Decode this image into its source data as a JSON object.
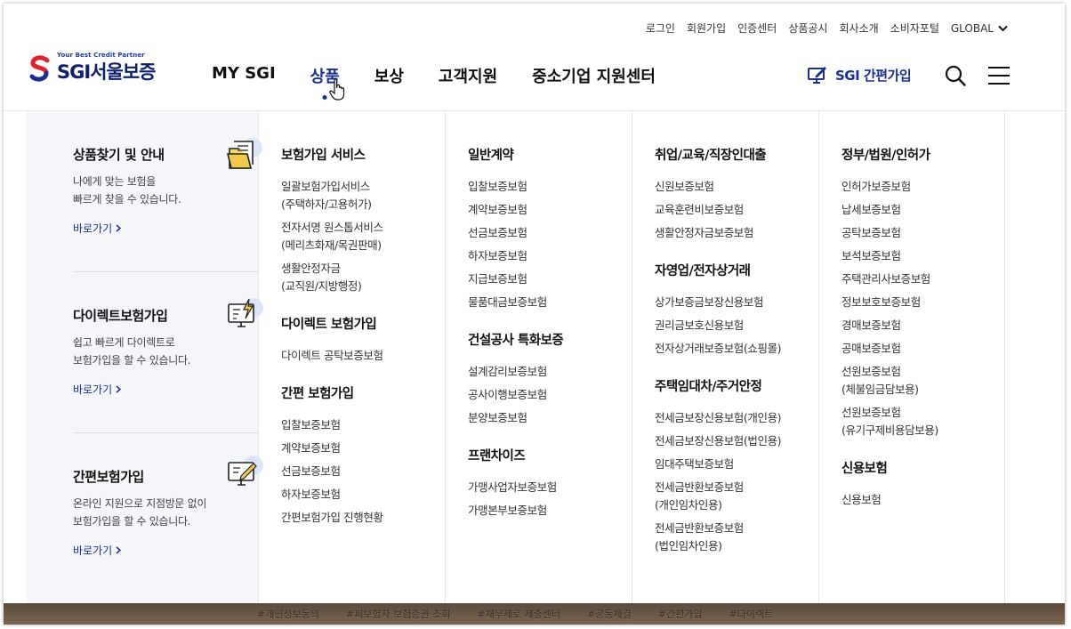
{
  "util_nav": [
    "로그인",
    "회원가입",
    "인증센터",
    "상품공시",
    "회사소개",
    "소비자포털"
  ],
  "global_label": "GLOBAL",
  "logo": {
    "tagline": "Your Best Credit Partner",
    "name": "SGI서울보증"
  },
  "gnb": [
    {
      "label": "MY SGI"
    },
    {
      "label": "상품"
    },
    {
      "label": "보상"
    },
    {
      "label": "고객지원"
    },
    {
      "label": "중소기업 지원센터"
    }
  ],
  "quick_join": "SGI 간편가입",
  "side_cards": [
    {
      "title": "상품찾기 및 안내",
      "desc1": "나에게 맞는 보험을",
      "desc2": "빠르게 찾을 수 있습니다.",
      "link": "바로가기",
      "icon": "document-folder-icon"
    },
    {
      "title": "다이렉트보험가입",
      "desc1": "쉽고 빠르게 다이렉트로",
      "desc2": "보험가입을 할 수 있습니다.",
      "link": "바로가기",
      "icon": "monitor-lightning-icon"
    },
    {
      "title": "간편보험가입",
      "desc1": "온라인 지원으로 지점방문 없이",
      "desc2": "보험가입을 할 수 있습니다.",
      "link": "바로가기",
      "icon": "monitor-pen-icon"
    }
  ],
  "columns": [
    {
      "groups": [
        {
          "title": "보험가입 서비스",
          "items": [
            {
              "l1": "일괄보험가입서비스",
              "l2": "(주택하자/고용허가)"
            },
            {
              "l1": "전자서명 원스톱서비스",
              "l2": "(메리츠화재/목권판매)"
            },
            {
              "l1": "생활안정자금",
              "l2": "(교직원/지방행정)"
            }
          ]
        },
        {
          "title": "다이렉트 보험가입",
          "items": [
            {
              "l1": "다이렉트 공탁보증보험",
              "l2": ""
            }
          ]
        },
        {
          "title": "간편 보험가입",
          "items": [
            {
              "l1": "입찰보증보험",
              "l2": ""
            },
            {
              "l1": "계약보증보험",
              "l2": ""
            },
            {
              "l1": "선금보증보험",
              "l2": ""
            },
            {
              "l1": "하자보증보험",
              "l2": ""
            },
            {
              "l1": "간편보험가입 진행현황",
              "l2": ""
            }
          ]
        }
      ]
    },
    {
      "groups": [
        {
          "title": "일반계약",
          "items": [
            {
              "l1": "입찰보증보험",
              "l2": ""
            },
            {
              "l1": "계약보증보험",
              "l2": ""
            },
            {
              "l1": "선금보증보험",
              "l2": ""
            },
            {
              "l1": "하자보증보험",
              "l2": ""
            },
            {
              "l1": "지급보증보험",
              "l2": ""
            },
            {
              "l1": "물품대금보증보험",
              "l2": ""
            }
          ]
        },
        {
          "title": "건설공사 특화보증",
          "items": [
            {
              "l1": "설계감리보증보험",
              "l2": ""
            },
            {
              "l1": "공사이행보증보험",
              "l2": ""
            },
            {
              "l1": "분양보증보험",
              "l2": ""
            }
          ]
        },
        {
          "title": "프랜차이즈",
          "items": [
            {
              "l1": "가맹사업자보증보험",
              "l2": ""
            },
            {
              "l1": "가맹본부보증보험",
              "l2": ""
            }
          ]
        }
      ]
    },
    {
      "groups": [
        {
          "title": "취업/교육/직장인대출",
          "items": [
            {
              "l1": "신원보증보험",
              "l2": ""
            },
            {
              "l1": "교육훈련비보증보험",
              "l2": ""
            },
            {
              "l1": "생활안정자금보증보험",
              "l2": ""
            }
          ]
        },
        {
          "title": "자영업/전자상거래",
          "items": [
            {
              "l1": "상가보증금보장신용보험",
              "l2": ""
            },
            {
              "l1": "권리금보호신용보험",
              "l2": ""
            },
            {
              "l1": "전자상거래보증보험(쇼핑몰)",
              "l2": ""
            }
          ]
        },
        {
          "title": "주택임대차/주거안정",
          "items": [
            {
              "l1": "전세금보장신용보험(개인용)",
              "l2": ""
            },
            {
              "l1": "전세금보장신용보험(법인용)",
              "l2": ""
            },
            {
              "l1": "임대주택보증보험",
              "l2": ""
            },
            {
              "l1": "전세금반환보증보험",
              "l2": "(개인임차인용)"
            },
            {
              "l1": "전세금반환보증보험",
              "l2": "(법인임차인용)"
            }
          ]
        }
      ]
    },
    {
      "groups": [
        {
          "title": "정부/법원/인허가",
          "items": [
            {
              "l1": "인허가보증보험",
              "l2": ""
            },
            {
              "l1": "납세보증보험",
              "l2": ""
            },
            {
              "l1": "공탁보증보험",
              "l2": ""
            },
            {
              "l1": "보석보증보험",
              "l2": ""
            },
            {
              "l1": "주택관리사보증보험",
              "l2": ""
            },
            {
              "l1": "정보보호보증보험",
              "l2": ""
            },
            {
              "l1": "경매보증보험",
              "l2": ""
            },
            {
              "l1": "공매보증보험",
              "l2": ""
            },
            {
              "l1": "선원보증보험",
              "l2": "(체불임금담보용)"
            },
            {
              "l1": "선원보증보험",
              "l2": "(유기구제비용담보용)"
            }
          ]
        },
        {
          "title": "신용보험",
          "items": [
            {
              "l1": "신용보험",
              "l2": ""
            }
          ]
        }
      ]
    }
  ],
  "footer_links": [
    "#개인정보동의",
    "#피보험자 보험증권 조회",
    "#채무제로 제출센터",
    "#공동체결",
    "#간편가입",
    "#다이렉트"
  ],
  "colors": {
    "brand_navy": "#1b2f8f",
    "side_bg": "#f5f6fa",
    "logo_red": "#e4202a"
  }
}
